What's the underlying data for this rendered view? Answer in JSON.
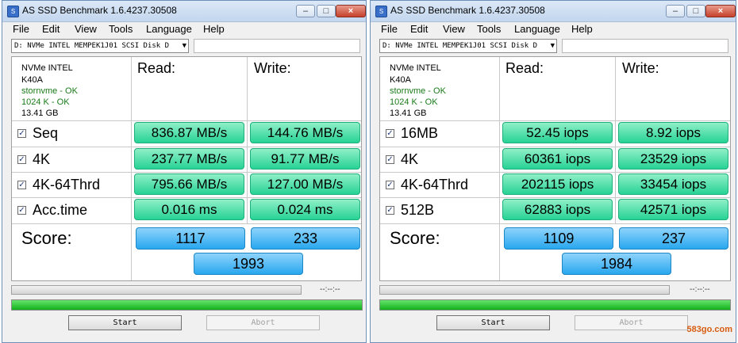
{
  "windows": [
    {
      "title": "AS SSD Benchmark 1.6.4237.30508",
      "menu": [
        "File",
        "Edit",
        "View",
        "Tools",
        "Language",
        "Help"
      ],
      "drive": "D: NVMe INTEL MEMPEK1J01 SCSI Disk D",
      "info": [
        "NVMe INTEL",
        "K40A",
        "stornvme - OK",
        "1024 K - OK",
        "13.41 GB"
      ],
      "headers": {
        "read": "Read:",
        "write": "Write:"
      },
      "rows": [
        {
          "label": "Seq",
          "read": "836.87 MB/s",
          "write": "144.76 MB/s"
        },
        {
          "label": "4K",
          "read": "237.77 MB/s",
          "write": "91.77 MB/s"
        },
        {
          "label": "4K-64Thrd",
          "read": "795.66 MB/s",
          "write": "127.00 MB/s"
        },
        {
          "label": "Acc.time",
          "read": "0.016 ms",
          "write": "0.024 ms"
        }
      ],
      "score": {
        "label": "Score:",
        "read": "1117",
        "write": "233",
        "total": "1993"
      },
      "time": "--:--:--",
      "start": "Start",
      "abort": "Abort"
    },
    {
      "title": "AS SSD Benchmark 1.6.4237.30508",
      "menu": [
        "File",
        "Edit",
        "View",
        "Tools",
        "Language",
        "Help"
      ],
      "drive": "D: NVMe INTEL MEMPEK1J01 SCSI Disk D",
      "info": [
        "NVMe INTEL",
        "K40A",
        "stornvme - OK",
        "1024 K - OK",
        "13.41 GB"
      ],
      "headers": {
        "read": "Read:",
        "write": "Write:"
      },
      "rows": [
        {
          "label": "16MB",
          "read": "52.45 iops",
          "write": "8.92 iops"
        },
        {
          "label": "4K",
          "read": "60361 iops",
          "write": "23529 iops"
        },
        {
          "label": "4K-64Thrd",
          "read": "202115 iops",
          "write": "33454 iops"
        },
        {
          "label": "512B",
          "read": "62883 iops",
          "write": "42571 iops"
        }
      ],
      "score": {
        "label": "Score:",
        "read": "1109",
        "write": "237",
        "total": "1984"
      },
      "time": "--:--:--",
      "start": "Start",
      "abort": "Abort"
    }
  ],
  "icons": {
    "minimize": "minimize-icon",
    "maximize": "maximize-icon",
    "close": "close-icon",
    "checkbox": "checkmark-icon"
  },
  "colors": {
    "result_green": "#27d295",
    "score_blue": "#28a7ee",
    "progress_green": "#11b21c"
  },
  "watermark": "583go.com"
}
